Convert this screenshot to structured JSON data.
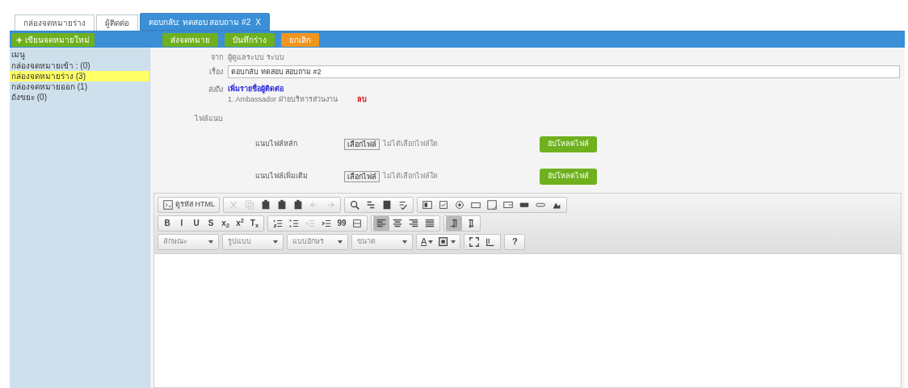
{
  "tabs": [
    {
      "label": "กล่องจดหมายร่าง",
      "selected": false
    },
    {
      "label": "ผู้ติดต่อ",
      "selected": false
    },
    {
      "label": "ตอบกลับ: ทดสอบ สอบถาม #2",
      "selected": true,
      "close": "X"
    }
  ],
  "new_button": {
    "icon": "+",
    "label": "เขียนจดหมายใหม่"
  },
  "actions": [
    {
      "label": "ส่งจดหมาย",
      "kind": "primary"
    },
    {
      "label": "บันทึกร่าง",
      "kind": "primary"
    },
    {
      "label": "ยกเลิก",
      "kind": "cancel"
    }
  ],
  "sidebar": {
    "title": "เมนู",
    "items": [
      {
        "label": "กล่องจดหมายเข้า : (0)",
        "selected": false
      },
      {
        "label": "กล่องจดหมายร่าง (3)",
        "selected": true
      },
      {
        "label": "กล่องจดหมายออก (1)",
        "selected": false
      },
      {
        "label": "ถังขยะ (0)",
        "selected": false
      }
    ]
  },
  "form": {
    "from": {
      "label": "จาก",
      "value": "ผู้ดูแลระบบ ระบบ"
    },
    "subject": {
      "label": "เรื่อง",
      "value": "ตอบกลับ ทดสอบ สอบถาม #2"
    },
    "to": {
      "label": "ส่งถึง",
      "link": "เพิ่มรายชื่อผู้ติดต่อ",
      "recipients": [
        {
          "name": "1. Ambassador ฝ่ายบริหารส่วนงาน",
          "remove": "ลบ"
        }
      ]
    },
    "attachments": {
      "label": "ไฟล์แนบ",
      "rows": [
        {
          "label": "แนบไฟล์หลัก",
          "choose": "เลือกไฟล์",
          "status": "ไม่ได้เลือกไฟล์ใด",
          "upload": "อัปโหลดไฟล์"
        },
        {
          "label": "แนบไฟล์เพิ่มเติม",
          "choose": "เลือกไฟล์",
          "status": "ไม่ได้เลือกไฟล์ใด",
          "upload": "อัปโหลดไฟล์"
        }
      ]
    }
  },
  "editor": {
    "toolbar_rows": [
      [
        [
          {
            "kind": "source",
            "label": "ดูรหัส HTML",
            "disabled": false
          }
        ],
        [
          {
            "kind": "cut",
            "disabled": true
          },
          {
            "kind": "copy",
            "disabled": true
          },
          {
            "kind": "paste",
            "disabled": false
          },
          {
            "kind": "paste",
            "disabled": false
          },
          {
            "kind": "paste",
            "disabled": false
          },
          {
            "kind": "undo",
            "disabled": true
          },
          {
            "kind": "redo",
            "disabled": true
          }
        ],
        [
          {
            "kind": "find",
            "disabled": false
          },
          {
            "kind": "replace",
            "disabled": false
          },
          {
            "kind": "selectall",
            "disabled": false
          },
          {
            "kind": "spell",
            "disabled": false
          }
        ],
        [
          {
            "kind": "form",
            "disabled": false
          },
          {
            "kind": "checkbox",
            "disabled": false
          },
          {
            "kind": "radio",
            "disabled": false
          },
          {
            "kind": "textfield",
            "disabled": false
          },
          {
            "kind": "textarea",
            "disabled": false
          },
          {
            "kind": "select",
            "disabled": false
          },
          {
            "kind": "button",
            "disabled": false
          },
          {
            "kind": "link",
            "disabled": false
          },
          {
            "kind": "image",
            "disabled": false
          }
        ]
      ],
      [
        [
          {
            "kind": "glyph",
            "label": "B",
            "disabled": false,
            "selected": false
          },
          {
            "kind": "glyph",
            "label": "I",
            "disabled": false,
            "selected": false
          },
          {
            "kind": "glyph",
            "label": "U",
            "disabled": false,
            "selected": false
          },
          {
            "kind": "glyph",
            "label": "S",
            "disabled": false,
            "selected": false
          },
          {
            "kind": "glyph",
            "label": "x$_{2}$",
            "disabled": false,
            "selected": false
          },
          {
            "kind": "glyph",
            "label": "x$^{2}$",
            "disabled": false,
            "selected": false
          },
          {
            "kind": "glyph",
            "label": "T$_{x}$",
            "disabled": false,
            "selected": false
          }
        ],
        [
          {
            "kind": "olist",
            "disabled": false,
            "selected": false
          },
          {
            "kind": "ulist",
            "disabled": false,
            "selected": false
          },
          {
            "kind": "outdent",
            "disabled": true,
            "selected": false
          },
          {
            "kind": "indent",
            "disabled": false,
            "selected": false
          },
          {
            "kind": "glyph",
            "label": "99",
            "disabled": false,
            "selected": false
          },
          {
            "kind": "div",
            "disabled": false,
            "selected": false
          }
        ],
        [
          {
            "kind": "alignleft",
            "disabled": false,
            "selected": true
          },
          {
            "kind": "aligncenter",
            "disabled": false,
            "selected": false
          },
          {
            "kind": "alignright",
            "disabled": false,
            "selected": false
          },
          {
            "kind": "justify",
            "disabled": false,
            "selected": false
          }
        ],
        [
          {
            "kind": "ltr",
            "disabled": false,
            "selected": true
          },
          {
            "kind": "rtl",
            "disabled": false,
            "selected": false
          }
        ]
      ]
    ],
    "combos": [
      {
        "label": "ลักษณะ"
      },
      {
        "label": "รูปแบบ"
      },
      {
        "label": "แบบอักษร"
      },
      {
        "label": "ขนาด"
      }
    ],
    "tools": [
      [
        {
          "kind": "textcolor",
          "label": "A"
        },
        {
          "kind": "bgcolor"
        }
      ],
      [
        {
          "kind": "maximize"
        },
        {
          "kind": "blocks"
        }
      ],
      [
        {
          "kind": "glyph",
          "label": "?"
        }
      ]
    ]
  }
}
